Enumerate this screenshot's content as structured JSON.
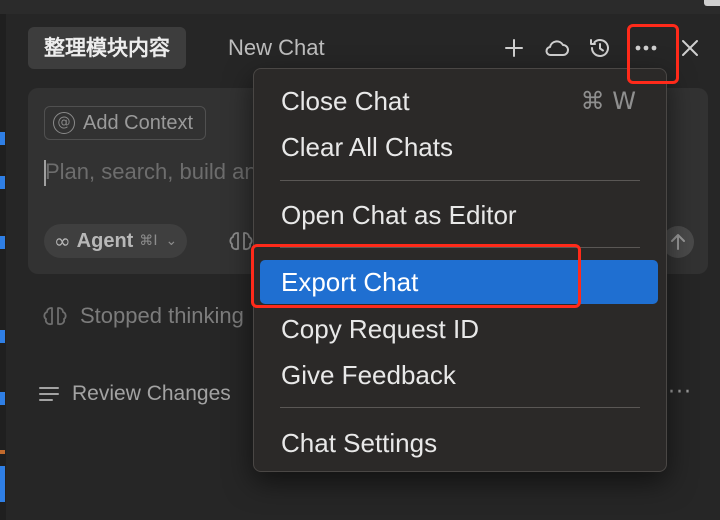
{
  "header": {
    "active_tab": "整理模块内容",
    "inactive_tab": "New Chat",
    "icons": [
      "plus-icon",
      "cloud-icon",
      "history-icon",
      "more-icon",
      "close-icon"
    ]
  },
  "composer": {
    "add_context_label": "Add Context",
    "prompt_placeholder": "Plan, search, build anything",
    "agent_label": "Agent",
    "agent_shortcut": "⌘I"
  },
  "status": {
    "thinking_text": "Stopped thinking",
    "review_label": "Review Changes"
  },
  "menu": {
    "items": [
      {
        "label": "Close Chat",
        "shortcut": "⌘ W"
      },
      {
        "label": "Clear All Chats",
        "shortcut": ""
      },
      {
        "label": "Open Chat as Editor",
        "shortcut": ""
      },
      {
        "label": "Export Chat",
        "shortcut": "",
        "selected": true
      },
      {
        "label": "Copy Request ID",
        "shortcut": ""
      },
      {
        "label": "Give Feedback",
        "shortcut": ""
      },
      {
        "label": "Chat Settings",
        "shortcut": ""
      }
    ]
  },
  "colors": {
    "accent": "#1f6fd1",
    "annotation": "#ff2a1a",
    "gutter_blue": "#2f7fe5"
  }
}
